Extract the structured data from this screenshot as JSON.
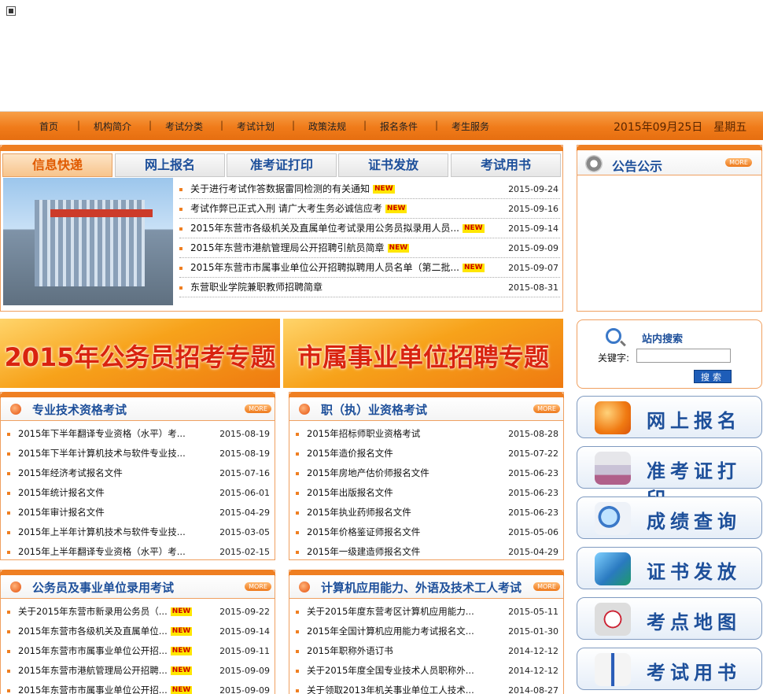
{
  "nav": {
    "items": [
      "首页",
      "机构简介",
      "考试分类",
      "考试计划",
      "政策法规",
      "报名条件",
      "考生服务"
    ],
    "separator": "|",
    "date": "2015年09月25日",
    "weekday": "星期五"
  },
  "news": {
    "tabs": [
      "信息快递",
      "网上报名",
      "准考证打印",
      "证书发放",
      "考试用书"
    ],
    "items": [
      {
        "title": "关于进行考试作答数据雷同检测的有关通知",
        "date": "2015-09-24",
        "is_new": true
      },
      {
        "title": "考试作弊已正式入刑 请广大考生务必诚信应考",
        "date": "2015-09-16",
        "is_new": true
      },
      {
        "title": "2015年东营市各级机关及直属单位考试录用公务员拟录用人员...",
        "date": "2015-09-14",
        "is_new": true
      },
      {
        "title": "2015年东营市港航管理局公开招聘引航员简章",
        "date": "2015-09-09",
        "is_new": true
      },
      {
        "title": "2015年东营市市属事业单位公开招聘拟聘用人员名单（第二批...",
        "date": "2015-09-07",
        "is_new": true
      },
      {
        "title": "东营职业学院兼职教师招聘简章",
        "date": "2015-08-31",
        "is_new": false
      }
    ],
    "new_label": "NEW"
  },
  "notice": {
    "title": "公告公示",
    "more": "MORE"
  },
  "search": {
    "title": "站内搜索",
    "label": "关键字:",
    "value": "",
    "button": "搜索"
  },
  "promos": [
    "2015年公务员招考专题",
    "市属事业单位招聘专题"
  ],
  "side_buttons": [
    {
      "label": "网上报名",
      "icon": "ie-icon"
    },
    {
      "label": "准考证打印",
      "icon": "printer-icon"
    },
    {
      "label": "成绩查询",
      "icon": "magnifier-document-icon"
    },
    {
      "label": "证书发放",
      "icon": "certificate-icon"
    },
    {
      "label": "考点地图",
      "icon": "compass-map-icon"
    },
    {
      "label": "考试用书",
      "icon": "book-icon"
    }
  ],
  "categories": [
    {
      "title": "专业技术资格考试",
      "more": "MORE",
      "items": [
        {
          "title": "2015年下半年翻译专业资格（水平）考...",
          "date": "2015-08-19",
          "is_new": false
        },
        {
          "title": "2015年下半年计算机技术与软件专业技...",
          "date": "2015-08-19",
          "is_new": false
        },
        {
          "title": "2015年经济考试报名文件",
          "date": "2015-07-16",
          "is_new": false
        },
        {
          "title": "2015年统计报名文件",
          "date": "2015-06-01",
          "is_new": false
        },
        {
          "title": "2015年审计报名文件",
          "date": "2015-04-29",
          "is_new": false
        },
        {
          "title": "2015年上半年计算机技术与软件专业技...",
          "date": "2015-03-05",
          "is_new": false
        },
        {
          "title": "2015年上半年翻译专业资格（水平）考...",
          "date": "2015-02-15",
          "is_new": false
        }
      ]
    },
    {
      "title": "职（执）业资格考试",
      "more": "MORE",
      "items": [
        {
          "title": "2015年招标师职业资格考试",
          "date": "2015-08-28",
          "is_new": false
        },
        {
          "title": "2015年造价报名文件",
          "date": "2015-07-22",
          "is_new": false
        },
        {
          "title": "2015年房地产估价师报名文件",
          "date": "2015-06-23",
          "is_new": false
        },
        {
          "title": "2015年出版报名文件",
          "date": "2015-06-23",
          "is_new": false
        },
        {
          "title": "2015年执业药师报名文件",
          "date": "2015-06-23",
          "is_new": false
        },
        {
          "title": "2015年价格鉴证师报名文件",
          "date": "2015-05-06",
          "is_new": false
        },
        {
          "title": "2015年一级建造师报名文件",
          "date": "2015-04-29",
          "is_new": false
        }
      ]
    },
    {
      "title": "公务员及事业单位录用考试",
      "more": "MORE",
      "items": [
        {
          "title": "关于2015年东营市新录用公务员（...",
          "date": "2015-09-22",
          "is_new": true
        },
        {
          "title": "2015年东营市各级机关及直属单位...",
          "date": "2015-09-14",
          "is_new": true
        },
        {
          "title": "2015年东营市市属事业单位公开招...",
          "date": "2015-09-11",
          "is_new": true
        },
        {
          "title": "2015年东营市港航管理局公开招聘...",
          "date": "2015-09-09",
          "is_new": true
        },
        {
          "title": "2015年东营市市属事业单位公开招...",
          "date": "2015-09-09",
          "is_new": true
        }
      ]
    },
    {
      "title": "计算机应用能力、外语及技术工人考试",
      "more": "MORE",
      "items": [
        {
          "title": "关于2015年度东营考区计算机应用能力...",
          "date": "2015-05-11",
          "is_new": false
        },
        {
          "title": "2015年全国计算机应用能力考试报名文...",
          "date": "2015-01-30",
          "is_new": false
        },
        {
          "title": "2015年职称外语订书",
          "date": "2014-12-12",
          "is_new": false
        },
        {
          "title": "关于2015年度全国专业技术人员职称外...",
          "date": "2014-12-12",
          "is_new": false
        },
        {
          "title": "关于领取2013年机关事业单位工人技术...",
          "date": "2014-08-27",
          "is_new": false
        }
      ]
    }
  ]
}
